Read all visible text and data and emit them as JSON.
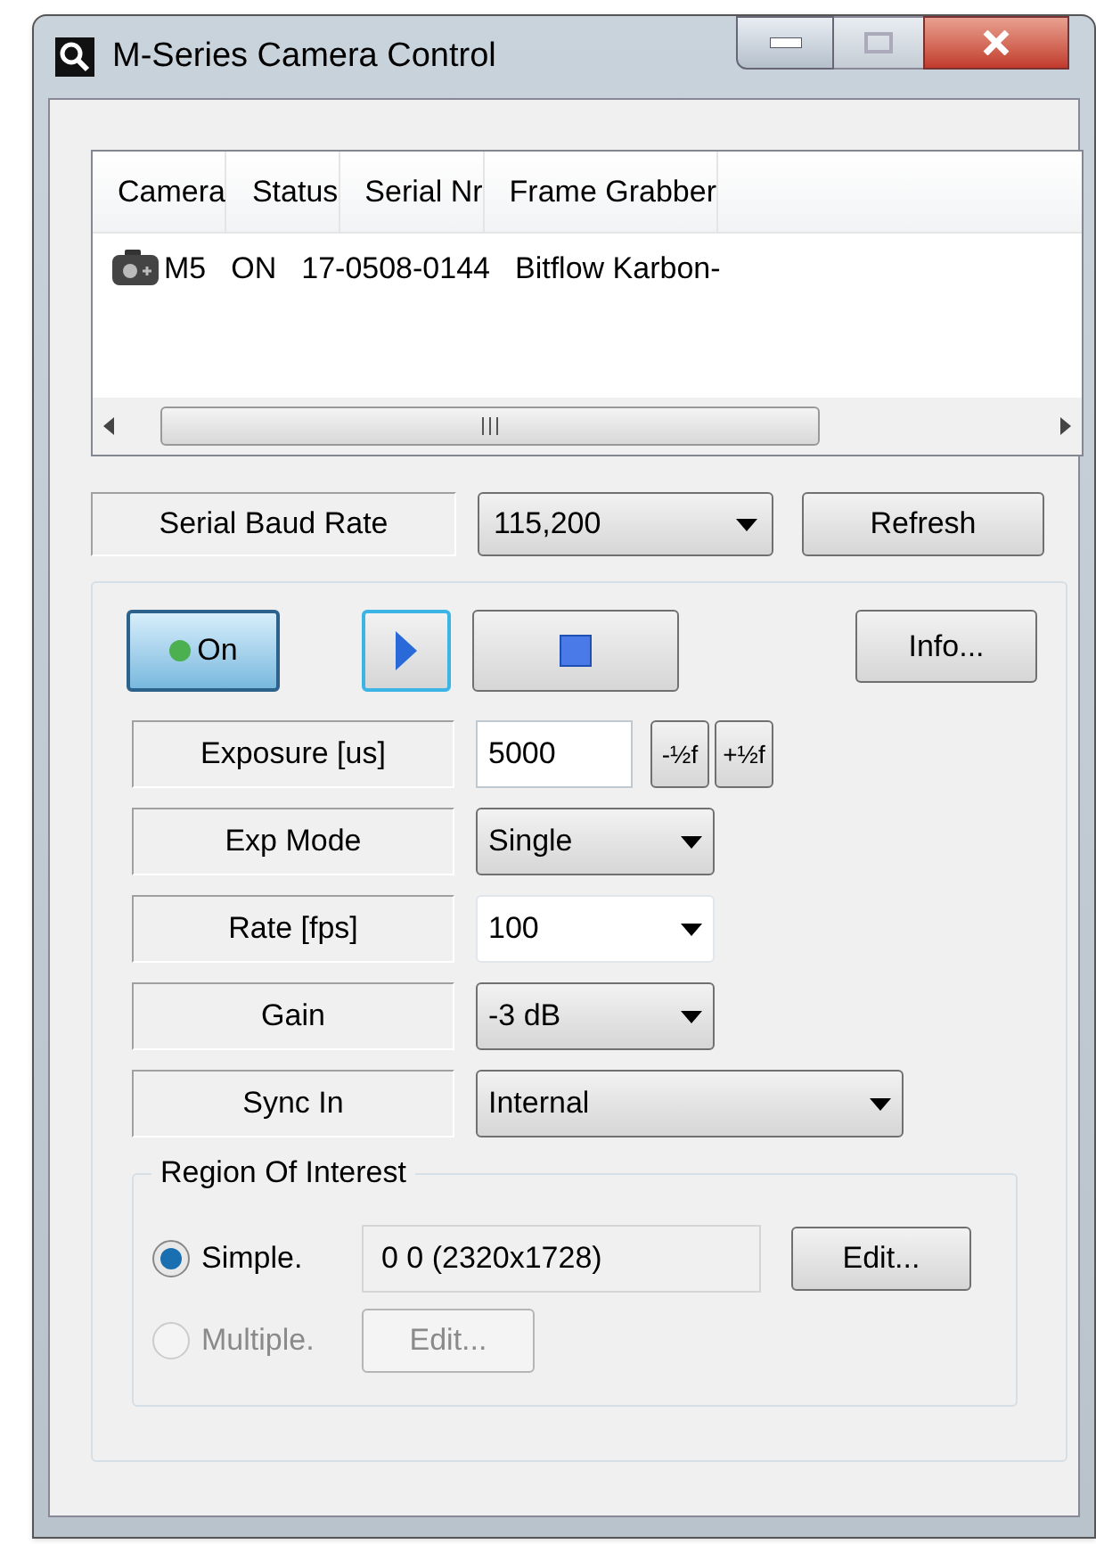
{
  "window": {
    "title": "M-Series Camera Control"
  },
  "table": {
    "columns": [
      "Camera",
      "Status",
      "Serial Nr",
      "Frame Grabber"
    ],
    "rows": [
      {
        "cells": [
          "M5",
          "ON",
          "17-0508-0144",
          "Bitflow Karbon-"
        ]
      }
    ]
  },
  "serial": {
    "label": "Serial Baud Rate",
    "value": "115,200",
    "refresh": "Refresh"
  },
  "controls": {
    "power": {
      "label": "On",
      "on": true
    },
    "info": "Info...",
    "rows": [
      {
        "label": "Exposure [us]",
        "kind": "text",
        "value": "5000",
        "steps": [
          "-½f",
          "+½f"
        ]
      },
      {
        "label": "Exp Mode",
        "kind": "dropdown",
        "value": "Single"
      },
      {
        "label": "Rate [fps]",
        "kind": "editable",
        "value": "100"
      },
      {
        "label": "Gain",
        "kind": "dropdown",
        "value": "-3 dB"
      },
      {
        "label": "Sync In",
        "kind": "dropdown",
        "value": "Internal",
        "wide": true
      }
    ]
  },
  "roi": {
    "title": "Region Of Interest",
    "options": [
      {
        "label": "Simple.",
        "selected": true,
        "disabled": false,
        "value": "0 0 (2320x1728)",
        "button": "Edit..."
      },
      {
        "label": "Multiple.",
        "selected": false,
        "disabled": true,
        "button": "Edit..."
      }
    ]
  }
}
